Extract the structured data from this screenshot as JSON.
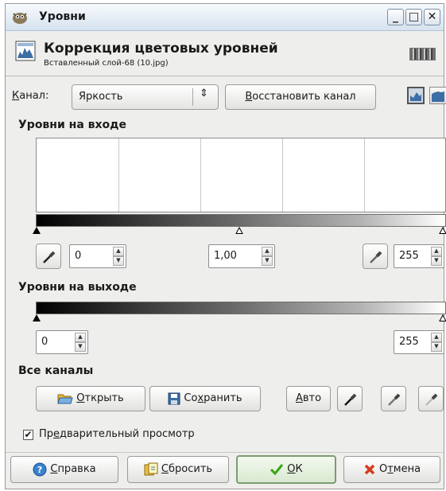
{
  "window": {
    "title": "Уровни",
    "buttons": {
      "minimize": "_",
      "maximize": "□",
      "close": "✕"
    }
  },
  "header": {
    "title": "Коррекция цветовых уровней",
    "subtitle": "Вставленный слой-68 (10.jpg)"
  },
  "channel": {
    "label_pre": "",
    "label_mnemonic": "К",
    "label_post": "анал:",
    "selected": "Яркость",
    "reset_pre": "",
    "reset_mnemonic": "В",
    "reset_post": "осстановить канал"
  },
  "input_levels": {
    "title": "Уровни на входе",
    "low": "0",
    "gamma": "1,00",
    "high": "255"
  },
  "output_levels": {
    "title": "Уровни на выходе",
    "low": "0",
    "high": "255"
  },
  "all_channels": {
    "title": "Все каналы",
    "open_mnemonic": "О",
    "open_post": "ткрыть",
    "save_pre": "Со",
    "save_mnemonic": "х",
    "save_post": "ранить",
    "auto_mnemonic": "А",
    "auto_post": "вто"
  },
  "preview": {
    "checked": true,
    "label_pre": "Пр",
    "label_mnemonic": "е",
    "label_post": "дварительный просмотр"
  },
  "footer": {
    "help_mnemonic": "С",
    "help_post": "правка",
    "reset_mnemonic": "С",
    "reset_post": "бросить",
    "ok_mnemonic": "О",
    "ok_post": "К",
    "cancel_pre": "О",
    "cancel_mnemonic": "т",
    "cancel_post": "мена"
  },
  "icons": {
    "app": "gimp-icon",
    "header": "levels-icon",
    "linear_hist": "linear-histogram-icon",
    "log_hist": "log-histogram-icon",
    "open": "folder-open-icon",
    "save": "floppy-disk-icon",
    "picker": "eyedropper-icon",
    "help": "help-icon",
    "reset": "reset-icon",
    "ok": "checkmark-icon",
    "cancel": "cancel-icon"
  },
  "colors": {
    "accent": "#3b6ea5",
    "ok_check": "#3aa514",
    "cancel_x": "#d43a1a"
  }
}
